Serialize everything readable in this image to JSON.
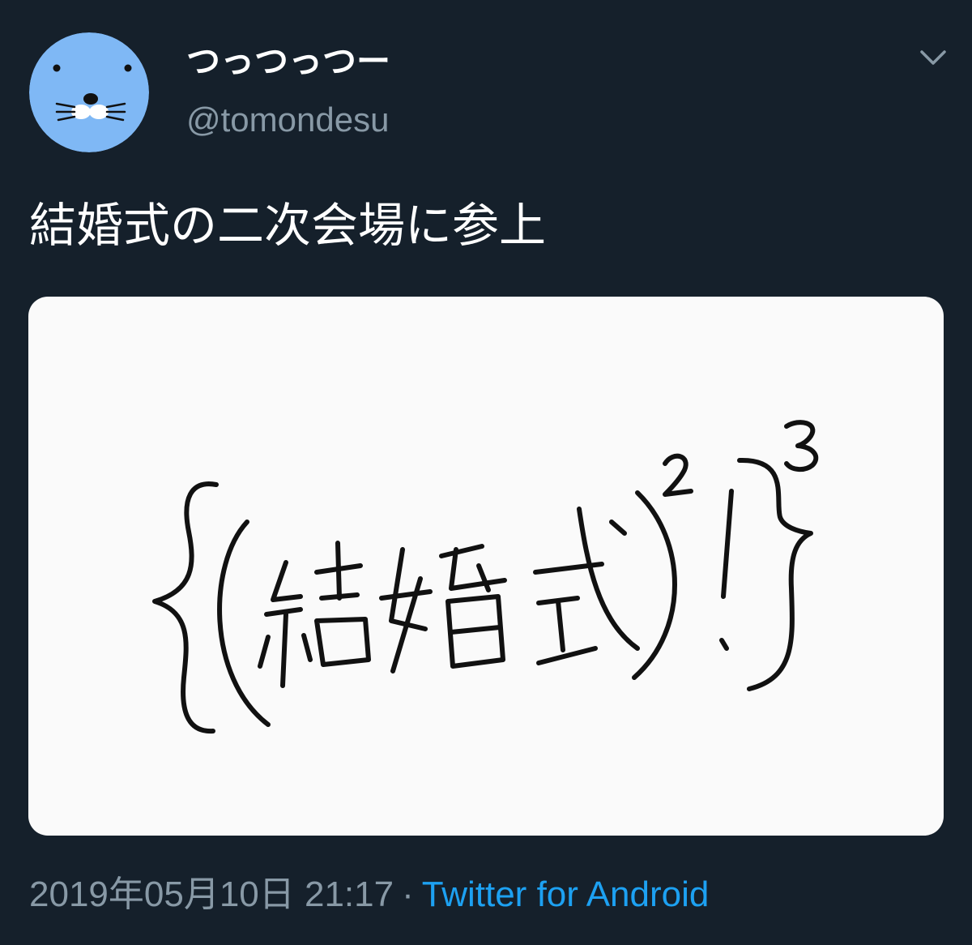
{
  "author": {
    "display_name": "つっつっつー",
    "handle": "@tomondesu",
    "avatar_icon": "seal-face-avatar",
    "avatar_color": "#7fb8f5"
  },
  "menu": {
    "icon": "chevron-down-icon"
  },
  "tweet": {
    "text": "結婚式の二次会場に参上",
    "image_text": "{(結婚式)²!}³"
  },
  "meta": {
    "timestamp": "2019年05月10日 21:17",
    "separator": "·",
    "source": "Twitter for Android"
  },
  "colors": {
    "background": "#15202b",
    "text": "#ffffff",
    "muted": "#8899a6",
    "link": "#1da1f2",
    "media_bg": "#fafafa"
  }
}
